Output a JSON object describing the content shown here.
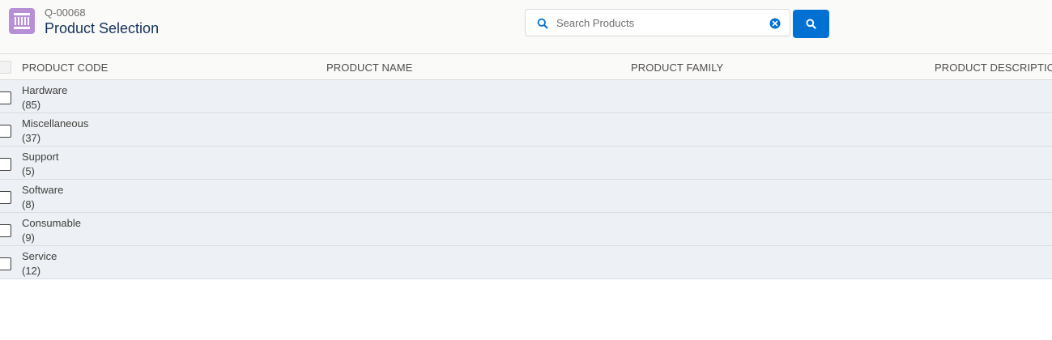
{
  "header": {
    "record_id": "Q-00068",
    "title": "Product Selection",
    "icon": "product-catalog-icon",
    "accent_color": "#b68fd6"
  },
  "search": {
    "placeholder": "Search Products",
    "value": "",
    "button_icon": "search-icon",
    "button_color": "#0070d2"
  },
  "table": {
    "columns": [
      "PRODUCT CODE",
      "PRODUCT NAME",
      "PRODUCT FAMILY",
      "PRODUCT DESCRIPTION"
    ],
    "groups": [
      {
        "name": "Hardware",
        "count": "(85)"
      },
      {
        "name": "Miscellaneous",
        "count": "(37)"
      },
      {
        "name": "Support",
        "count": "(5)"
      },
      {
        "name": "Software",
        "count": "(8)"
      },
      {
        "name": "Consumable",
        "count": "(9)"
      },
      {
        "name": "Service",
        "count": "(12)"
      }
    ]
  }
}
